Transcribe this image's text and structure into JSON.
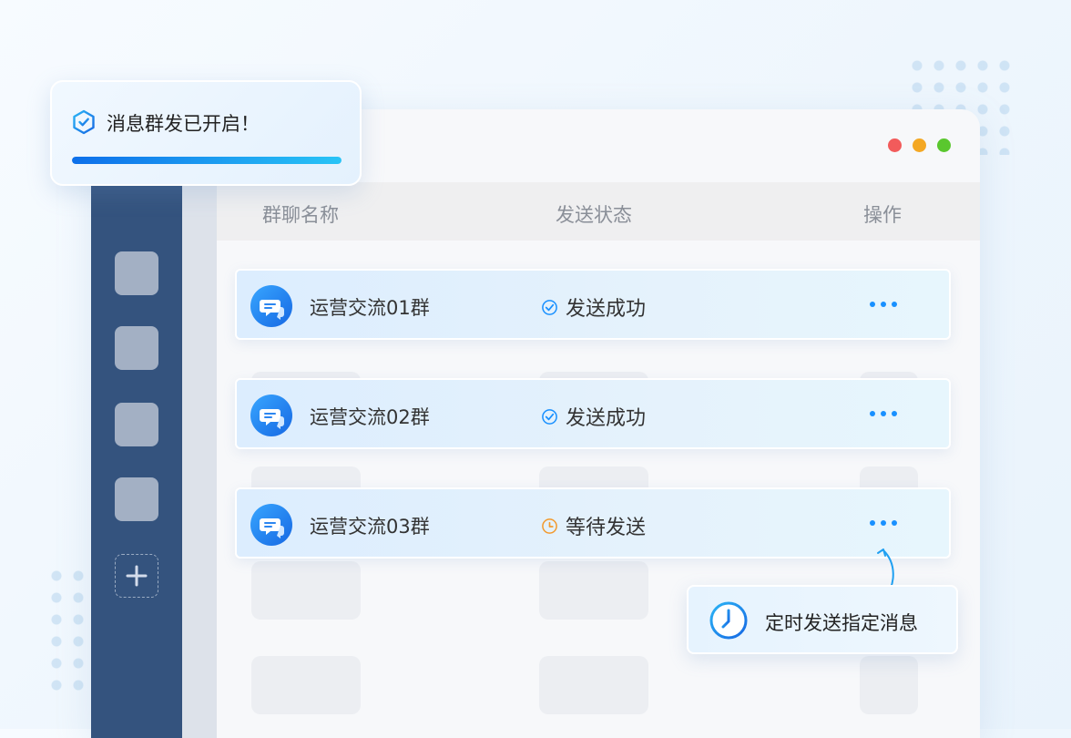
{
  "toast": {
    "text": "消息群发已开启！",
    "progress": 1.0
  },
  "window": {
    "controls": [
      "close-dot",
      "minimize-dot",
      "maximize-dot"
    ],
    "control_colors": [
      "#f25b5b",
      "#f4a824",
      "#5ac72e"
    ]
  },
  "table": {
    "headers": [
      "群聊名称",
      "发送状态",
      "操作"
    ],
    "rows": [
      {
        "name": "运营交流01群",
        "status": "发送成功",
        "status_icon": "check-circle-icon"
      },
      {
        "name": "运营交流02群",
        "status": "发送成功",
        "status_icon": "check-circle-icon"
      },
      {
        "name": "运营交流03群",
        "status": "等待发送",
        "status_icon": "clock-icon"
      }
    ]
  },
  "tooltip": {
    "text": "定时发送指定消息",
    "icon": "clock-icon"
  },
  "colors": {
    "accent": "#1890ff",
    "sidebar": "#34537e",
    "success": "#1890ff",
    "pending": "#f29a2e"
  }
}
